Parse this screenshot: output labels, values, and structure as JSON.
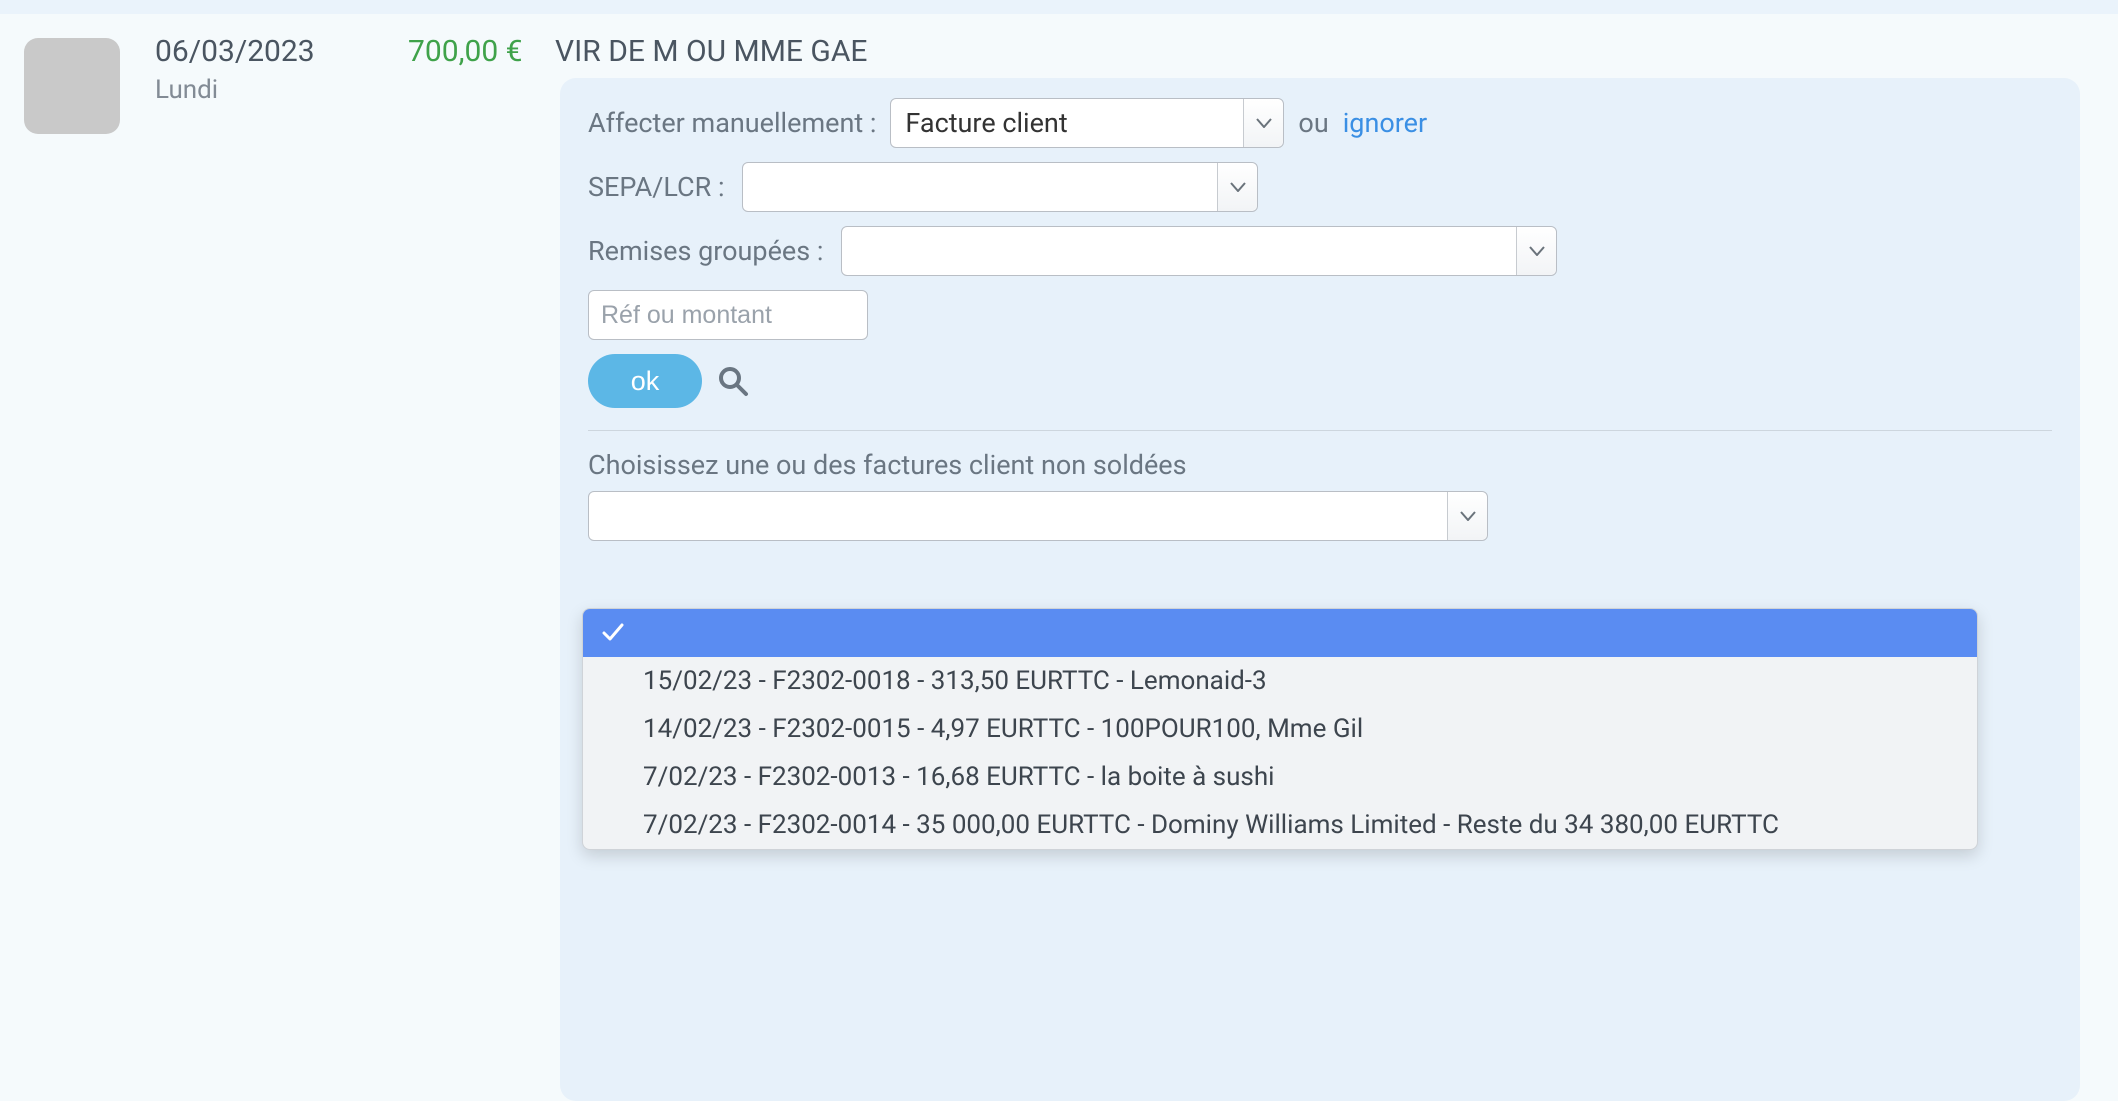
{
  "transaction": {
    "date": "06/03/2023",
    "dow": "Lundi",
    "amount": "700,00 €",
    "description": "VIR DE M OU MME GAE"
  },
  "assign": {
    "label": "Affecter manuellement :",
    "value": "Facture client",
    "or": "ou",
    "ignore": "ignorer"
  },
  "sepa": {
    "label": "SEPA/LCR :",
    "value": ""
  },
  "remises": {
    "label": "Remises groupées :",
    "value": ""
  },
  "ref": {
    "placeholder": "Réf ou montant"
  },
  "ok_label": "ok",
  "choose_label": "Choisissez une ou des factures client non soldées",
  "invoice_select_value": "",
  "dropdown": {
    "selected": "",
    "items": [
      "15/02/23 - F2302-0018 - 313,50 EURTTC - Lemonaid-3",
      "14/02/23 - F2302-0015 - 4,97 EURTTC - 100POUR100, Mme Gil",
      "7/02/23 - F2302-0013 - 16,68 EURTTC - la boite à sushi",
      "7/02/23 - F2302-0014 - 35 000,00 EURTTC - Dominy Williams Limited - Reste du 34 380,00 EURTTC"
    ]
  }
}
